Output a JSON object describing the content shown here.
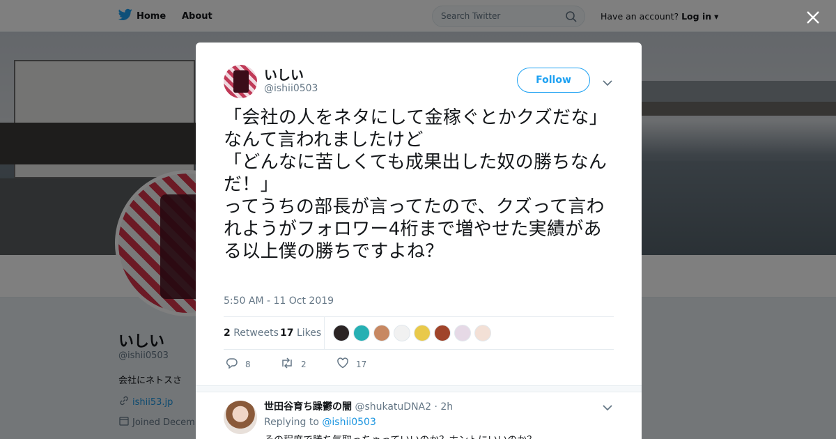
{
  "topbar": {
    "home_label": "Home",
    "about_label": "About",
    "search_placeholder": "Search Twitter",
    "account_prompt": "Have an account?",
    "login_label": "Log in"
  },
  "profile": {
    "name": "いしい",
    "handle": "@ishii0503",
    "bio": "会社にネトスさ",
    "link": "ishii53.jp",
    "joined": "Joined Decem"
  },
  "tweet": {
    "author_name": "いしい",
    "author_handle": "@ishii0503",
    "follow_label": "Follow",
    "text": "「会社の人をネタにして金稼ぐとかクズだな」\nなんて言われましたけど\n「どんなに苦しくても成果出した奴の勝ちなんだ！」\nってうちの部長が言ってたので、クズって言われようがフォロワー4桁まで増やせた実績がある以上僕の勝ちですよね？",
    "time": "5:50 AM - 11 Oct 2019",
    "retweets_count": "2",
    "retweets_label": "Retweets",
    "likes_count": "17",
    "likes_label": "Likes",
    "likers_colors": [
      "#2b2424",
      "#27b0b3",
      "#c78862",
      "#f1f1f1",
      "#e9c94a",
      "#a0442a",
      "#e6d9e6",
      "#f3e0d6"
    ],
    "actions": {
      "reply_count": "8",
      "retweet_count": "2",
      "like_count": "17"
    }
  },
  "reply": {
    "name": "世田谷育ち躁鬱の闇",
    "handle": "@shukatuDNA2",
    "time": "· 2h",
    "replying_prefix": "Replying to",
    "replying_to": "@ishii0503",
    "text": "その程度で勝ち気取っちゃっていいのか？ホントにいいのか？"
  },
  "colors": {
    "brand_blue": "#1da1f2",
    "link_blue": "#1b95e0",
    "secondary_text": "#657786"
  }
}
